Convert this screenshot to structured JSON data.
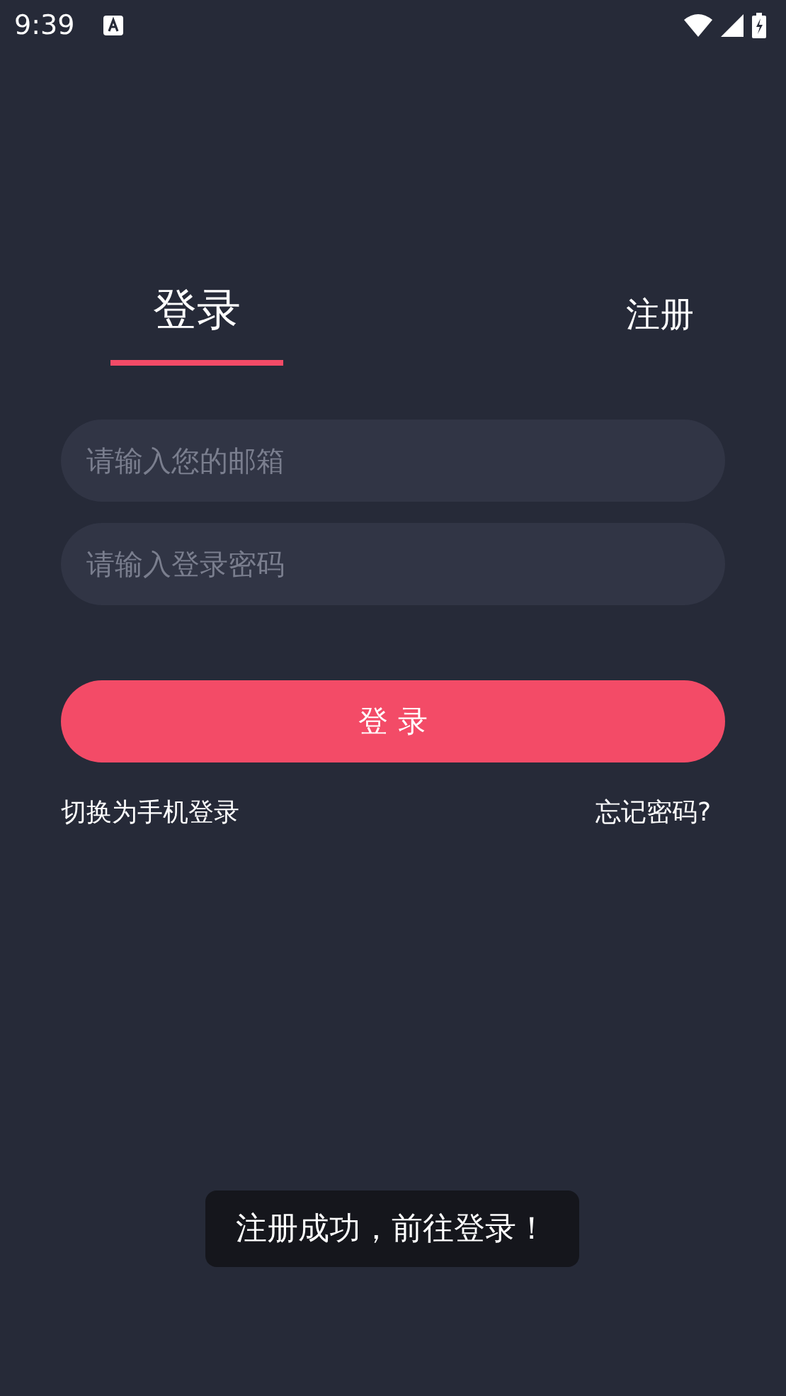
{
  "status_bar": {
    "time": "9:39"
  },
  "tabs": [
    {
      "label": "登录",
      "selected": true
    },
    {
      "label": "注册",
      "selected": false
    }
  ],
  "fields": [
    {
      "placeholder": "请输入您的邮箱"
    },
    {
      "placeholder": "请输入登录密码"
    }
  ],
  "submit_button": "登 录",
  "links": {
    "switch": "切换为手机登录",
    "forgot": "忘记密码?"
  },
  "toast": "注册成功，前往登录！"
}
